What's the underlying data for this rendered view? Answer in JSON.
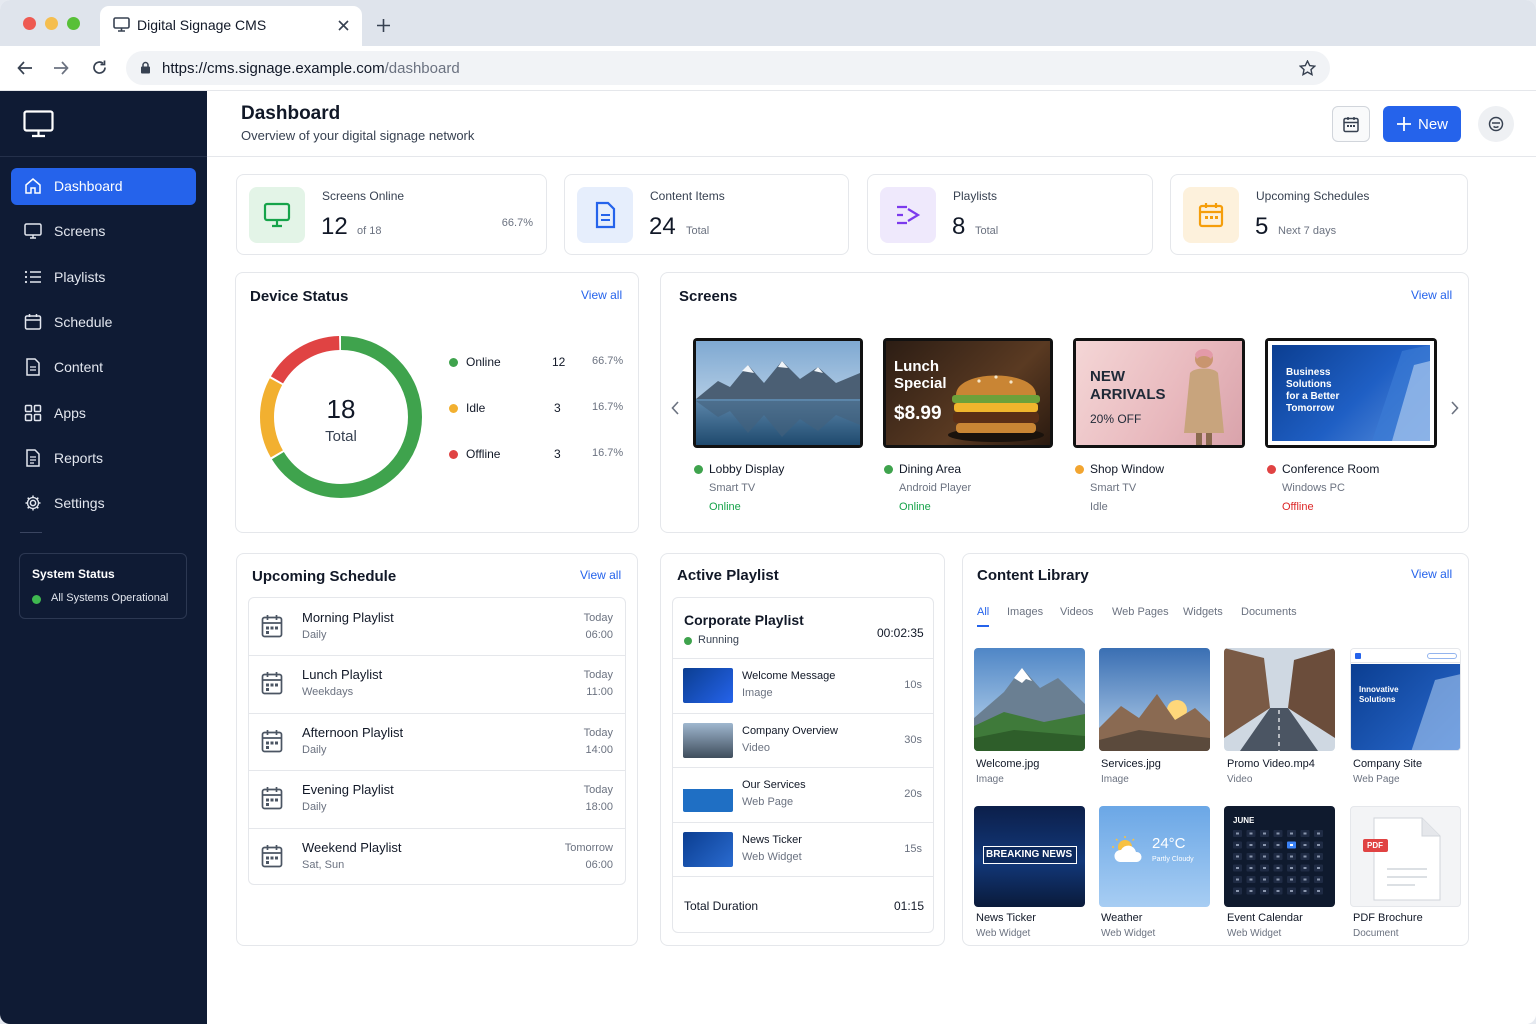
{
  "browser": {
    "tab_title": "Digital Signage CMS",
    "url_host": "https://cms.signage.example.com",
    "url_path": "/dashboard"
  },
  "header": {
    "title": "Dashboard",
    "subtitle": "Overview of your digital signage network",
    "new_label": "New"
  },
  "sidebar": {
    "items": [
      {
        "label": "Dashboard",
        "icon": "home-icon",
        "active": true
      },
      {
        "label": "Screens",
        "icon": "monitor-icon"
      },
      {
        "label": "Playlists",
        "icon": "list-icon"
      },
      {
        "label": "Schedule",
        "icon": "calendar-icon"
      },
      {
        "label": "Content",
        "icon": "file-icon"
      },
      {
        "label": "Apps",
        "icon": "grid-icon"
      },
      {
        "label": "Reports",
        "icon": "report-icon"
      },
      {
        "label": "Settings",
        "icon": "gear-icon"
      }
    ],
    "system_status": {
      "title": "System Status",
      "text": "All Systems Operational"
    }
  },
  "stats": [
    {
      "label": "Screens Online",
      "value": "12",
      "sub": "of 18",
      "extra": "66.7%",
      "color": "#16a34a",
      "bg": "#e3f4e7"
    },
    {
      "label": "Content Items",
      "value": "24",
      "sub": "Total",
      "extra": "",
      "color": "#2563eb",
      "bg": "#e6eefc"
    },
    {
      "label": "Playlists",
      "value": "8",
      "sub": "Total",
      "extra": "",
      "color": "#7c3aed",
      "bg": "#efe9fc"
    },
    {
      "label": "Upcoming Schedules",
      "value": "5",
      "sub": "Next 7 days",
      "extra": "",
      "color": "#f59e0b",
      "bg": "#fdf1dc"
    }
  ],
  "device_status": {
    "title": "Device Status",
    "view_all": "View all",
    "total": "18",
    "total_label": "Total",
    "items": [
      {
        "label": "Online",
        "count": 12,
        "pct": "66.7%",
        "color": "#3fa34d"
      },
      {
        "label": "Idle",
        "count": 3,
        "pct": "16.7%",
        "color": "#f2b030"
      },
      {
        "label": "Offline",
        "count": 3,
        "pct": "16.7%",
        "color": "#e04343"
      }
    ]
  },
  "screens": {
    "title": "Screens",
    "view_all": "View all",
    "items": [
      {
        "name": "Lobby Display",
        "type": "Smart TV",
        "status": "Online",
        "color": "#3fa34d"
      },
      {
        "name": "Dining Area",
        "type": "Android Player",
        "status": "Online",
        "color": "#3fa34d"
      },
      {
        "name": "Shop Window",
        "type": "Smart TV",
        "status": "Idle",
        "color": "#f2a530"
      },
      {
        "name": "Conference Room",
        "type": "Windows PC",
        "status": "Offline",
        "color": "#e04343"
      }
    ],
    "promo_lunch": {
      "l1": "Lunch",
      "l2": "Special",
      "price": "$8.99"
    },
    "promo_shop": {
      "l1": "NEW",
      "l2": "ARRIVALS",
      "l3": "20% OFF"
    },
    "promo_business": {
      "l1": "Business",
      "l2": "Solutions",
      "l3": "for a Better",
      "l4": "Tomorrow"
    }
  },
  "schedule": {
    "title": "Upcoming Schedule",
    "view_all": "View all",
    "items": [
      {
        "name": "Morning Playlist",
        "freq": "Daily",
        "day": "Today",
        "time": "06:00"
      },
      {
        "name": "Lunch Playlist",
        "freq": "Weekdays",
        "day": "Today",
        "time": "11:00"
      },
      {
        "name": "Afternoon Playlist",
        "freq": "Daily",
        "day": "Today",
        "time": "14:00"
      },
      {
        "name": "Evening Playlist",
        "freq": "Daily",
        "day": "Today",
        "time": "18:00"
      },
      {
        "name": "Weekend Playlist",
        "freq": "Sat, Sun",
        "day": "Tomorrow",
        "time": "06:00"
      }
    ]
  },
  "playlist": {
    "title": "Active Playlist",
    "name": "Corporate Playlist",
    "status": "Running",
    "duration": "00:02:35",
    "items": [
      {
        "name": "Welcome Message",
        "type": "Image",
        "dur": "10s"
      },
      {
        "name": "Company Overview",
        "type": "Video",
        "dur": "30s"
      },
      {
        "name": "Our Services",
        "type": "Web Page",
        "dur": "20s"
      },
      {
        "name": "News Ticker",
        "type": "Web Widget",
        "dur": "15s"
      }
    ],
    "total_label": "Total Duration",
    "total": "01:15"
  },
  "library": {
    "title": "Content Library",
    "view_all": "View all",
    "tabs": [
      "All",
      "Images",
      "Videos",
      "Web Pages",
      "Widgets",
      "Documents"
    ],
    "items": [
      {
        "name": "Welcome.jpg",
        "type": "Image"
      },
      {
        "name": "Services.jpg",
        "type": "Image"
      },
      {
        "name": "Promo Video.mp4",
        "type": "Video"
      },
      {
        "name": "Company Site",
        "type": "Web Page"
      },
      {
        "name": "News Ticker",
        "type": "Web Widget"
      },
      {
        "name": "Weather",
        "type": "Web Widget"
      },
      {
        "name": "Event Calendar",
        "type": "Web Widget"
      },
      {
        "name": "PDF Brochure",
        "type": "Document"
      }
    ],
    "thumb_text": {
      "breaking": "BREAKING NEWS",
      "temp": "24°C",
      "cond": "Partly Cloudy",
      "month": "JUNE",
      "pdf": "PDF",
      "site_l1": "Innovative",
      "site_l2": "Solutions"
    }
  }
}
